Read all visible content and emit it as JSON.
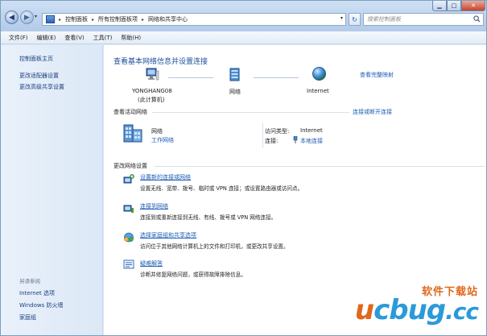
{
  "address_bar": {
    "breadcrumbs": [
      "控制面板",
      "所有控制面板项",
      "网络和共享中心"
    ],
    "search_placeholder": "搜索控制面板"
  },
  "menu": [
    "文件(F)",
    "编辑(E)",
    "查看(V)",
    "工具(T)",
    "帮助(H)"
  ],
  "sidebar": {
    "items": [
      "控制面板主页",
      "更改适配器设置",
      "更改高级共享设置"
    ],
    "see_also_title": "另请参阅",
    "see_also": [
      "Internet 选项",
      "Windows 防火墙",
      "家庭组"
    ]
  },
  "main": {
    "title": "查看基本网络信息并设置连接",
    "full_map_link": "查看完整映射",
    "map": {
      "computer_name": "YONGHANG08",
      "computer_sub": "(此计算机)",
      "network": "网络",
      "internet": "Internet"
    },
    "active_section": "查看活动网络",
    "connect_link": "连接或断开连接",
    "active_network": {
      "name": "网络",
      "type_link": "工作网络",
      "access_label": "访问类型:",
      "access_value": "Internet",
      "connection_label": "连接:",
      "connection_value": "本地连接"
    },
    "change_section": "更改网络设置",
    "tasks": [
      {
        "title": "设置新的连接或网络",
        "desc": "设置无线、宽带、拨号、临时或 VPN 连接；或设置路由器或访问点。"
      },
      {
        "title": "连接到网络",
        "desc": "连接到或重新连接到无线、有线、拨号或 VPN 网络连接。"
      },
      {
        "title": "选择家庭组和共享选项",
        "desc": "访问位于其他网络计算机上的文件和打印机，或更改共享设置。"
      },
      {
        "title": "疑难解答",
        "desc": "诊断并修复网络问题，或获得故障排除信息。"
      }
    ]
  },
  "watermark": {
    "top": "软件下载站",
    "brand_u": "u",
    "brand_rest": "cbug",
    "suffix": ".cc"
  },
  "colors": {
    "link": "#1b5cb4",
    "title": "#1c4f9c",
    "sidebar_bg": "#dce8f6"
  }
}
